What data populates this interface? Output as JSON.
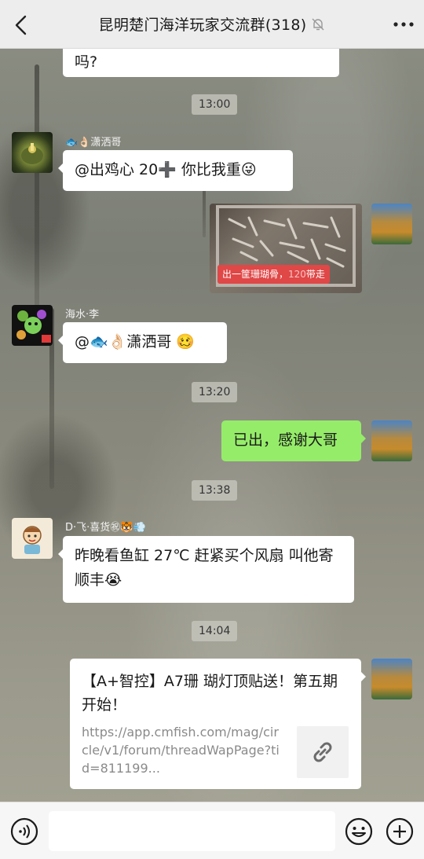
{
  "header": {
    "title": "昆明楚门海洋玩家交流群(318)",
    "back_icon": "chevron-left-icon",
    "mute_icon": "bell-off-icon",
    "more_icon": "more-dots-icon"
  },
  "messages": {
    "partial_top": {
      "text": "吗?"
    },
    "time1": "13:00",
    "msg1": {
      "sender": "🐟👌🏻潇洒哥",
      "text": "@出鸡心 20➕  你比我重😜"
    },
    "msg2": {
      "caption_main": "出一筐珊瑚骨，",
      "caption_dim": "120",
      "caption_end": "带走"
    },
    "msg3": {
      "sender": "海水·李",
      "text": "@🐟👌🏻潇洒哥  🥴"
    },
    "time2": "13:20",
    "msg4": {
      "text": "已出，感谢大哥"
    },
    "time3": "13:38",
    "msg5": {
      "sender": "D·飞·喜货㊗🐯💨",
      "text": "昨晚看鱼缸 27℃  赶紧买个风扇 叫他寄顺丰😭"
    },
    "time4": "14:04",
    "msg6": {
      "title": "【A+智控】A7珊 瑚灯顶贴送！第五期开始！",
      "url": "https://app.cmfish.com/mag/circle/v1/forum/threadWapPage?tid=811199...",
      "link_icon": "link-icon"
    }
  },
  "input_bar": {
    "voice_icon": "voice-icon",
    "emoji_icon": "emoji-icon",
    "plus_icon": "plus-icon",
    "placeholder": ""
  },
  "colors": {
    "green_bubble": "#95ec69",
    "header_bg": "#ededed",
    "caption_red": "#e04747"
  }
}
